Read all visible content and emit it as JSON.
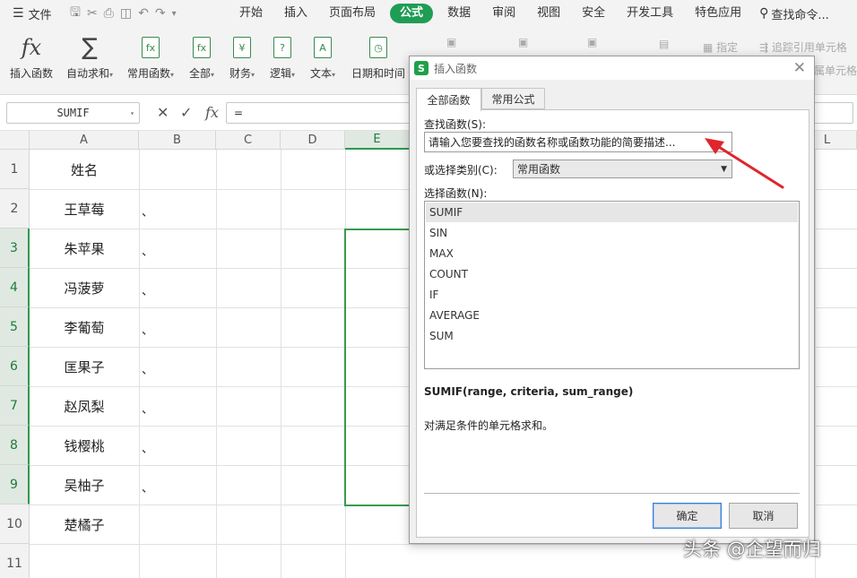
{
  "menubar": {
    "file_label": "文件",
    "tabs": [
      "开始",
      "插入",
      "页面布局",
      "公式",
      "数据",
      "审阅",
      "视图",
      "安全",
      "开发工具",
      "特色应用"
    ],
    "active_tab": "公式",
    "search_label": "查找命令..."
  },
  "ribbon": {
    "insert_function": "插入函数",
    "autosum": "自动求和",
    "common_functions": "常用函数",
    "all": "全部",
    "finance": "财务",
    "logic": "逻辑",
    "text": "文本",
    "datetime": "日期和时间",
    "name_manager": "指定",
    "trace_precedents": "追踪引用单元格",
    "trace_dependents": "追踪从属单元格"
  },
  "formula_bar": {
    "name_box": "SUMIF",
    "formula": "="
  },
  "sheet": {
    "columns": [
      "A",
      "B",
      "C",
      "D",
      "E",
      "L"
    ],
    "selected_column": "E",
    "rows": [
      "1",
      "2",
      "3",
      "4",
      "5",
      "6",
      "7",
      "8",
      "9",
      "10",
      "11"
    ],
    "selected_rows": [
      "3",
      "4",
      "5",
      "6",
      "7",
      "8",
      "9"
    ],
    "col_a": [
      "姓名",
      "王草莓",
      "朱苹果",
      "冯菠萝",
      "李葡萄",
      "匡果子",
      "赵凤梨",
      "钱樱桃",
      "吴柚子",
      "楚橘子"
    ],
    "col_b": [
      "",
      "、",
      "、",
      "、",
      "、",
      "、",
      "、",
      "、",
      "、",
      ""
    ]
  },
  "dialog": {
    "title": "插入函数",
    "close_icon": "close-icon",
    "tabs": [
      "全部函数",
      "常用公式"
    ],
    "active_tab": "全部函数",
    "search_label": "查找函数(S):",
    "search_value": "请输入您要查找的函数名称或函数功能的简要描述...",
    "category_label": "或选择类别(C):",
    "category_value": "常用函数",
    "function_list_label": "选择函数(N):",
    "functions": [
      "SUMIF",
      "SIN",
      "MAX",
      "COUNT",
      "IF",
      "AVERAGE",
      "SUM"
    ],
    "selected_function": "SUMIF",
    "signature": "SUMIF(range, criteria, sum_range)",
    "description": "对满足条件的单元格求和。",
    "ok_label": "确定",
    "cancel_label": "取消"
  },
  "annotation": {
    "arrow_color": "#e0252b"
  },
  "watermark": "头条 @企望而归",
  "colors": {
    "accent": "#1f9d55",
    "selection": "#3a9a4e"
  }
}
